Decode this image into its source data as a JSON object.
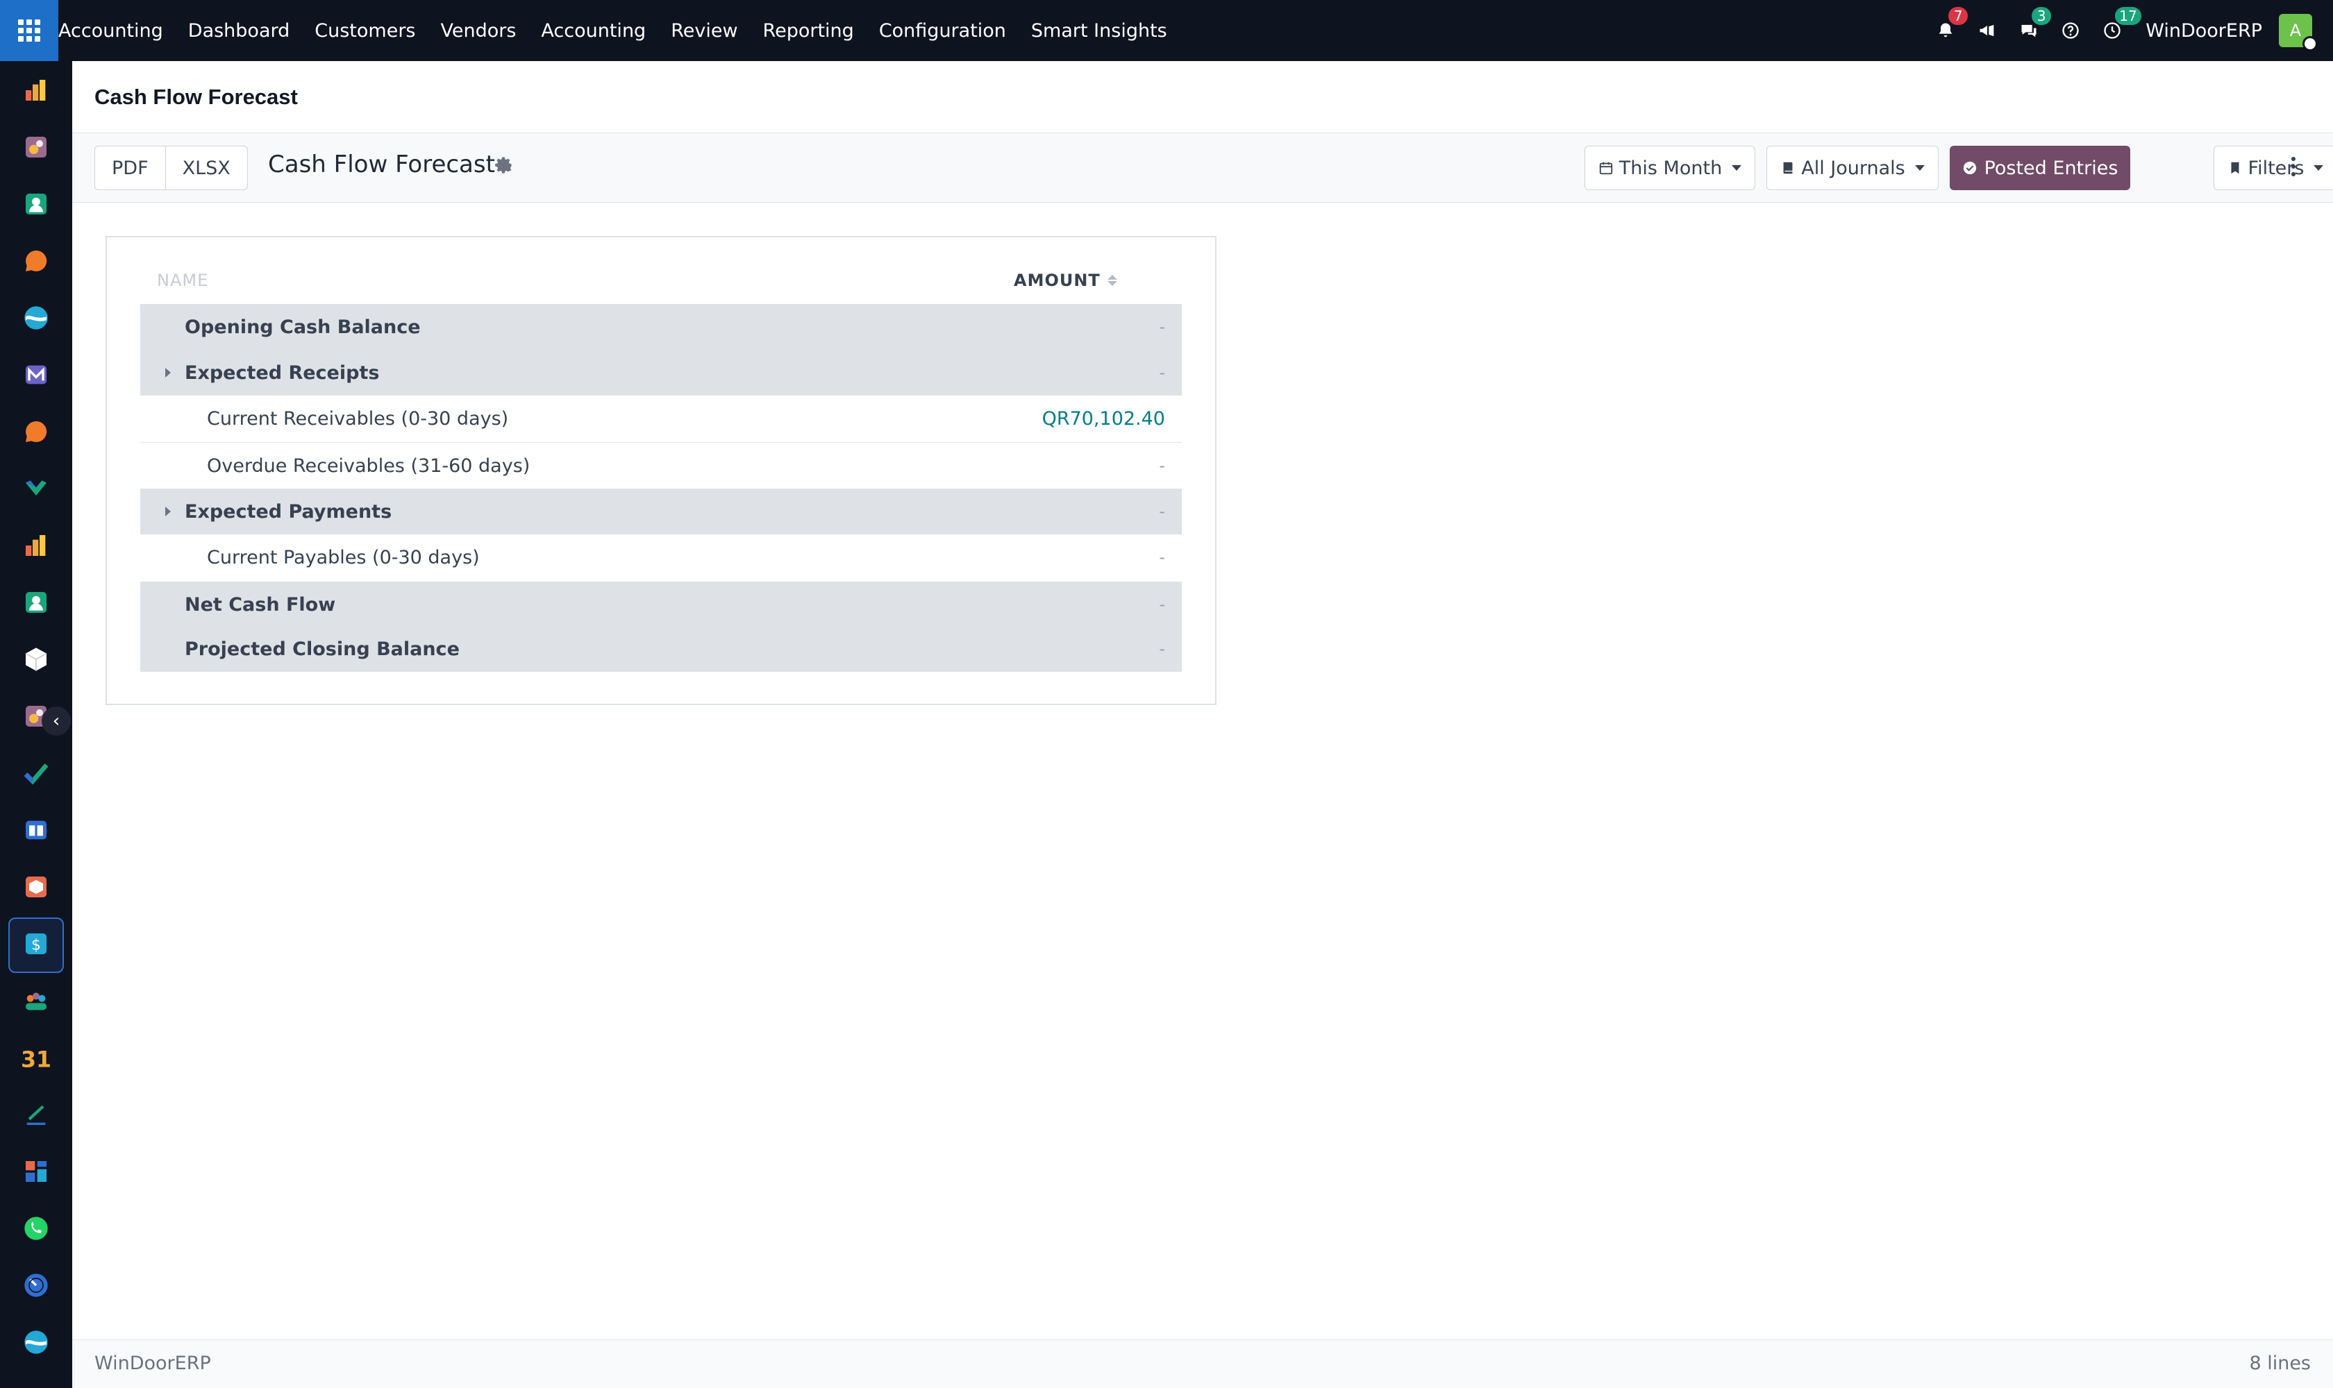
{
  "topbar": {
    "app_name": "Accounting",
    "menu": [
      "Dashboard",
      "Customers",
      "Vendors",
      "Accounting",
      "Review",
      "Reporting",
      "Configuration",
      "Smart Insights"
    ],
    "notifications_count": "7",
    "messages_count": "3",
    "activities_count": "17",
    "company": "WinDoorERP",
    "avatar_initial": "A"
  },
  "sidebar": {
    "icons": [
      "invoicing-icon",
      "sales-icon",
      "contacts-icon",
      "discuss-icon",
      "website-icon",
      "email-marketing-icon",
      "live-chat-icon",
      "project-icon",
      "reporting-icon",
      "employees-icon",
      "inventory-icon",
      "purchase-icon",
      "todo-icon",
      "knowledge-icon",
      "apps-icon",
      "accounting-icon",
      "team-icon",
      "calendar-icon",
      "sign-icon",
      "dashboards-icon",
      "whatsapp-icon",
      "time-off-icon",
      "website-builder-icon"
    ]
  },
  "breadcrumb": {
    "title": "Cash Flow Forecast"
  },
  "control": {
    "pdf_label": "PDF",
    "xlsx_label": "XLSX",
    "report_title": "Cash Flow Forecast",
    "period_label": "This Month",
    "journals_label": "All Journals",
    "posted_label": "Posted Entries",
    "filters_label": "Filters"
  },
  "table": {
    "col_name": "NAME",
    "col_amount": "AMOUNT",
    "rows": [
      {
        "label": "Opening Cash Balance",
        "amount": "-"
      },
      {
        "label": "Expected Receipts",
        "amount": "-"
      },
      {
        "label": "Current Receivables (0-30 days)",
        "amount": "QR70,102.40"
      },
      {
        "label": "Overdue Receivables (31-60 days)",
        "amount": "-"
      },
      {
        "label": "Expected Payments",
        "amount": "-"
      },
      {
        "label": "Current Payables (0-30 days)",
        "amount": "-"
      },
      {
        "label": "Net Cash Flow",
        "amount": "-"
      },
      {
        "label": "Projected Closing Balance",
        "amount": "-"
      }
    ]
  },
  "footer": {
    "company": "WinDoorERP",
    "line_count": "8 lines"
  }
}
